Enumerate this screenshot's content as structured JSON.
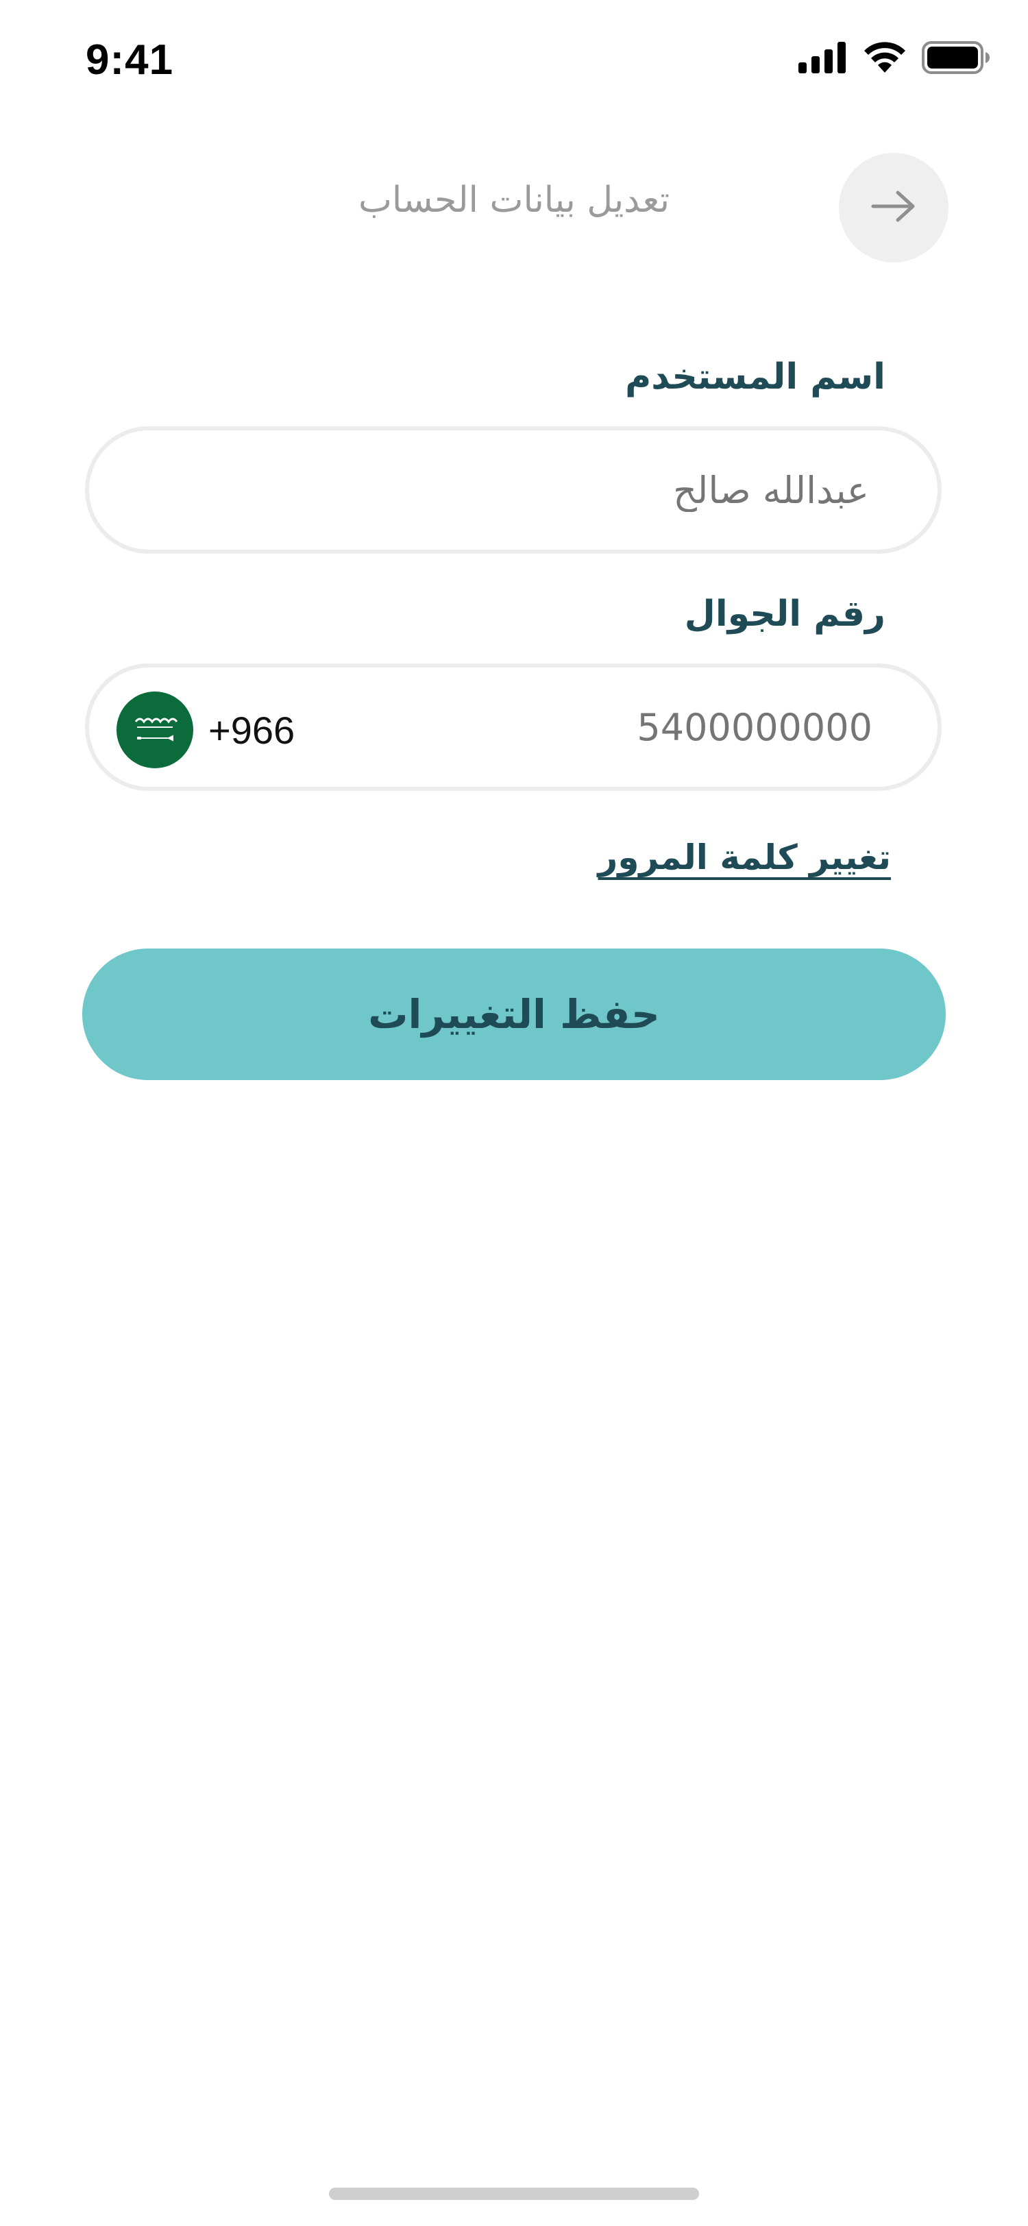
{
  "status_bar": {
    "time": "9:41",
    "icons": [
      "signal-icon",
      "wifi-icon",
      "battery-icon"
    ]
  },
  "header": {
    "title": "تعديل بيانات الحساب",
    "back_icon": "arrow-right-icon"
  },
  "form": {
    "username": {
      "label": "اسم المستخدم",
      "value": "",
      "placeholder": "عبدالله صالح"
    },
    "phone": {
      "label": "رقم الجوال",
      "country_flag": "saudi-flag-icon",
      "dial_code": "+966",
      "value": "",
      "placeholder": "5400000000"
    },
    "change_password_link": "تغيير كلمة المرور",
    "save_button": "حفظ التغييرات"
  },
  "colors": {
    "primary_text": "#1f4b57",
    "button_bg": "#70c7ca",
    "input_border": "#ececec",
    "placeholder": "#9a9a9a",
    "flag_green": "#0b6b3a"
  }
}
